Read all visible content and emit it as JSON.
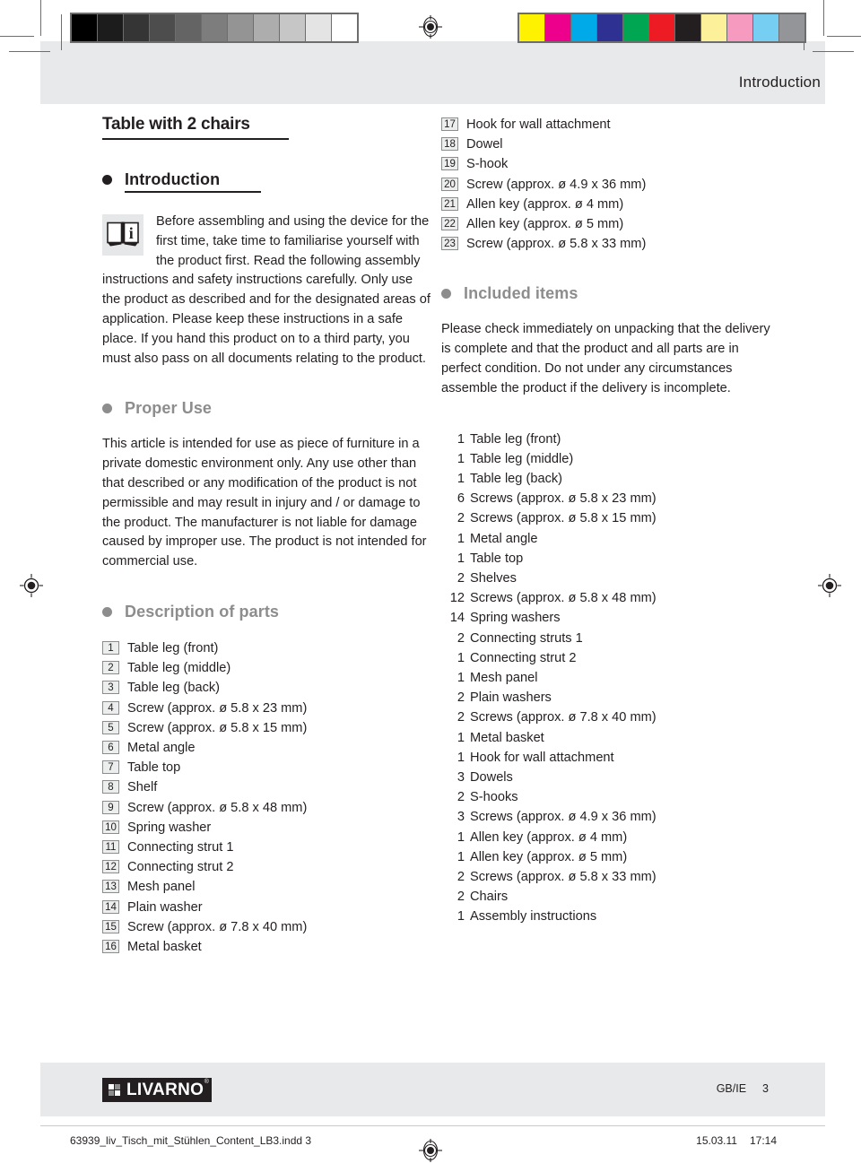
{
  "header": {
    "running_title": "Introduction",
    "gray_bar_name": "grayscale-calibration-bar",
    "color_bar_name": "color-calibration-bar",
    "gray_swatches": [
      "#000000",
      "#1c1c1c",
      "#353535",
      "#4d4d4d",
      "#646464",
      "#7d7d7d",
      "#949494",
      "#adadad",
      "#c6c6c6",
      "#e4e4e4",
      "#ffffff"
    ],
    "color_swatches": [
      "#fff200",
      "#ec008c",
      "#00a9e8",
      "#2e3192",
      "#00a651",
      "#ed1c24",
      "#231f20",
      "#fdf09a",
      "#f79ac0",
      "#76cff3",
      "#939598"
    ]
  },
  "doc": {
    "title": "Table with 2 chairs"
  },
  "introduction": {
    "heading": "Introduction",
    "icon_name": "manual-book-info-icon",
    "icon_letter": "i",
    "paragraph": "Before assembling and using the device for the first time, take time to familiarise yourself with the product first. Read the following assembly instructions and safety instructions carefully. Only use the product as described and for the designated areas of application. Please keep these instructions in a safe place. If you hand this product on to a third party, you must also pass on all documents relating to the product."
  },
  "proper_use": {
    "heading": "Proper Use",
    "paragraph": "This article is intended for use as piece of furniture in a private domestic environment only. Any use other than that described or any modification of the product is not permissible and may result in injury and / or damage to the product. The manufacturer is not liable for damage caused by improper use. The product is not intended for commercial use."
  },
  "description_of_parts": {
    "heading": "Description of parts",
    "items": [
      {
        "num": "1",
        "label": "Table leg (front)"
      },
      {
        "num": "2",
        "label": "Table leg (middle)"
      },
      {
        "num": "3",
        "label": "Table leg (back)"
      },
      {
        "num": "4",
        "label": "Screw (approx. ø 5.8 x 23 mm)"
      },
      {
        "num": "5",
        "label": "Screw (approx. ø 5.8 x 15 mm)"
      },
      {
        "num": "6",
        "label": "Metal angle"
      },
      {
        "num": "7",
        "label": "Table top"
      },
      {
        "num": "8",
        "label": "Shelf"
      },
      {
        "num": "9",
        "label": "Screw (approx. ø 5.8 x 48 mm)"
      },
      {
        "num": "10",
        "label": "Spring washer"
      },
      {
        "num": "11",
        "label": "Connecting strut 1"
      },
      {
        "num": "12",
        "label": "Connecting strut 2"
      },
      {
        "num": "13",
        "label": "Mesh panel"
      },
      {
        "num": "14",
        "label": "Plain washer"
      },
      {
        "num": "15",
        "label": "Screw (approx. ø 7.8 x 40 mm)"
      },
      {
        "num": "16",
        "label": "Metal basket"
      }
    ],
    "items_right": [
      {
        "num": "17",
        "label": "Hook for wall attachment"
      },
      {
        "num": "18",
        "label": "Dowel"
      },
      {
        "num": "19",
        "label": "S-hook"
      },
      {
        "num": "20",
        "label": "Screw (approx. ø 4.9 x 36 mm)"
      },
      {
        "num": "21",
        "label": "Allen key (approx. ø 4 mm)"
      },
      {
        "num": "22",
        "label": "Allen key (approx. ø 5 mm)"
      },
      {
        "num": "23",
        "label": "Screw (approx. ø 5.8 x 33 mm)"
      }
    ]
  },
  "included_items": {
    "heading": "Included items",
    "paragraph": "Please check immediately on unpacking that the delivery is complete and that the product and all parts are in perfect condition. Do not under any circumstances assemble the product if the delivery is incomplete.",
    "items": [
      {
        "qty": "1",
        "label": "Table leg (front)"
      },
      {
        "qty": "1",
        "label": "Table leg (middle)"
      },
      {
        "qty": "1",
        "label": "Table leg (back)"
      },
      {
        "qty": "6",
        "label": "Screws (approx. ø 5.8 x 23 mm)"
      },
      {
        "qty": "2",
        "label": "Screws (approx. ø 5.8 x 15 mm)"
      },
      {
        "qty": "1",
        "label": "Metal angle"
      },
      {
        "qty": "1",
        "label": "Table top"
      },
      {
        "qty": "2",
        "label": "Shelves"
      },
      {
        "qty": "12",
        "label": "Screws (approx. ø 5.8 x 48 mm)"
      },
      {
        "qty": "14",
        "label": "Spring washers"
      },
      {
        "qty": "2",
        "label": "Connecting struts 1"
      },
      {
        "qty": "1",
        "label": "Connecting strut 2"
      },
      {
        "qty": "1",
        "label": "Mesh panel"
      },
      {
        "qty": "2",
        "label": "Plain washers"
      },
      {
        "qty": "2",
        "label": "Screws (approx. ø 7.8 x 40 mm)"
      },
      {
        "qty": "1",
        "label": "Metal basket"
      },
      {
        "qty": "1",
        "label": "Hook for wall attachment"
      },
      {
        "qty": "3",
        "label": "Dowels"
      },
      {
        "qty": "2",
        "label": "S-hooks"
      },
      {
        "qty": "3",
        "label": "Screws (approx. ø 4.9 x 36 mm)"
      },
      {
        "qty": "1",
        "label": "Allen key (approx. ø 4 mm)"
      },
      {
        "qty": "1",
        "label": "Allen key (approx. ø 5 mm)"
      },
      {
        "qty": "2",
        "label": "Screws (approx. ø 5.8 x 33 mm)"
      },
      {
        "qty": "2",
        "label": "Chairs"
      },
      {
        "qty": "1",
        "label": "Assembly instructions"
      }
    ]
  },
  "footer": {
    "logo_word": "LIVARNO",
    "logo_registered": "®",
    "locale": "GB/IE",
    "page_number": "3"
  },
  "slug": {
    "filename": "63939_liv_Tisch_mit_Stühlen_Content_LB3.indd   3",
    "date": "15.03.11",
    "time": "17:14"
  }
}
